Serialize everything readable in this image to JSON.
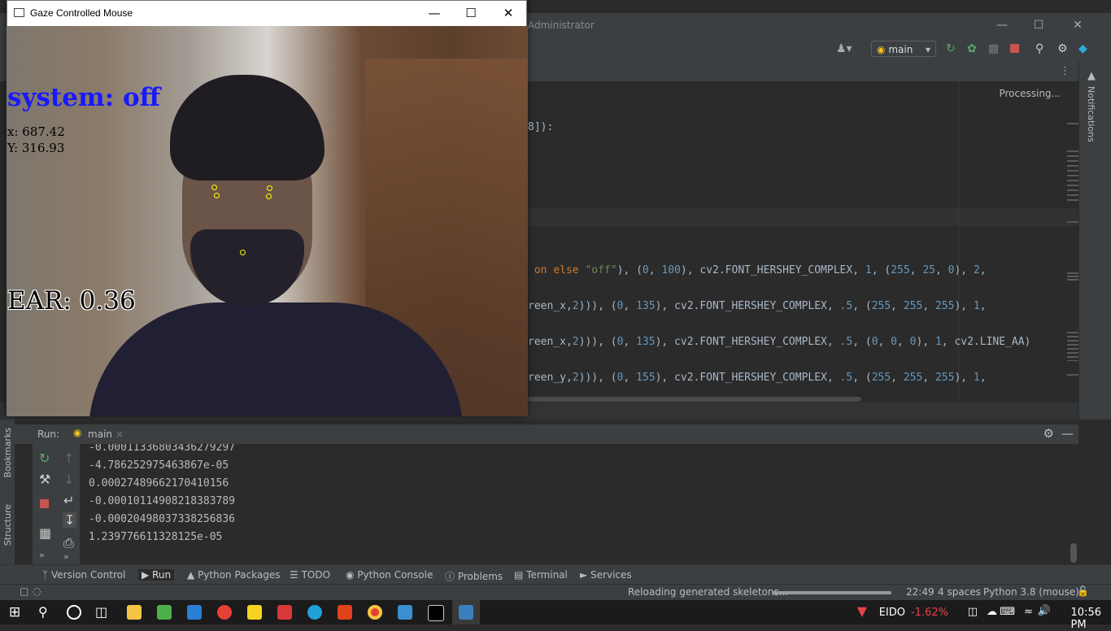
{
  "gaze_window": {
    "title": "Gaze Controlled Mouse",
    "system_status": "system: off",
    "x_readout": "x: 687.42",
    "y_readout": "Y: 316.93",
    "ear_readout": "EAR: 0.36"
  },
  "ide": {
    "title_suffix": "Administrator",
    "run_config": "main",
    "processing": "Processing...",
    "notifications_label": "Notifications",
    "code_lines": [
      {
        "parts": [
          {
            "t": "8]):",
            "c": ""
          }
        ]
      },
      {
        "parts": [
          {
            "t": " on ",
            "c": "kw"
          },
          {
            "t": "else ",
            "c": "kw"
          },
          {
            "t": "\"off\"",
            "c": "str"
          },
          {
            "t": "), (",
            "c": ""
          },
          {
            "t": "0",
            "c": "num"
          },
          {
            "t": ", ",
            "c": ""
          },
          {
            "t": "100",
            "c": "num"
          },
          {
            "t": "), cv2.FONT_HERSHEY_COMPLEX, ",
            "c": ""
          },
          {
            "t": "1",
            "c": "num"
          },
          {
            "t": ", (",
            "c": ""
          },
          {
            "t": "255",
            "c": "num"
          },
          {
            "t": ", ",
            "c": ""
          },
          {
            "t": "25",
            "c": "num"
          },
          {
            "t": ", ",
            "c": ""
          },
          {
            "t": "0",
            "c": "num"
          },
          {
            "t": "), ",
            "c": ""
          },
          {
            "t": "2",
            "c": "num"
          },
          {
            "t": ",",
            "c": ""
          }
        ]
      },
      {
        "parts": [
          {
            "t": "reen_x",
            "c": ""
          },
          {
            "t": ",",
            "c": ""
          },
          {
            "t": "2",
            "c": "num"
          },
          {
            "t": "))), (",
            "c": ""
          },
          {
            "t": "0",
            "c": "num"
          },
          {
            "t": ", ",
            "c": ""
          },
          {
            "t": "135",
            "c": "num"
          },
          {
            "t": "), cv2.FONT_HERSHEY_COMPLEX, ",
            "c": ""
          },
          {
            "t": ".5",
            "c": "num"
          },
          {
            "t": ", (",
            "c": ""
          },
          {
            "t": "255",
            "c": "num"
          },
          {
            "t": ", ",
            "c": ""
          },
          {
            "t": "255",
            "c": "num"
          },
          {
            "t": ", ",
            "c": ""
          },
          {
            "t": "255",
            "c": "num"
          },
          {
            "t": "), ",
            "c": ""
          },
          {
            "t": "1",
            "c": "num"
          },
          {
            "t": ",",
            "c": ""
          }
        ]
      },
      {
        "parts": [
          {
            "t": "reen_x",
            "c": ""
          },
          {
            "t": ",",
            "c": ""
          },
          {
            "t": "2",
            "c": "num"
          },
          {
            "t": "))), (",
            "c": ""
          },
          {
            "t": "0",
            "c": "num"
          },
          {
            "t": ", ",
            "c": ""
          },
          {
            "t": "135",
            "c": "num"
          },
          {
            "t": "), cv2.FONT_HERSHEY_COMPLEX, ",
            "c": ""
          },
          {
            "t": ".5",
            "c": "num"
          },
          {
            "t": ", (",
            "c": ""
          },
          {
            "t": "0",
            "c": "num"
          },
          {
            "t": ", ",
            "c": ""
          },
          {
            "t": "0",
            "c": "num"
          },
          {
            "t": ", ",
            "c": ""
          },
          {
            "t": "0",
            "c": "num"
          },
          {
            "t": "), ",
            "c": ""
          },
          {
            "t": "1",
            "c": "num"
          },
          {
            "t": ", cv2.LINE_AA)",
            "c": ""
          }
        ]
      },
      {
        "parts": [
          {
            "t": "reen_y",
            "c": ""
          },
          {
            "t": ",",
            "c": ""
          },
          {
            "t": "2",
            "c": "num"
          },
          {
            "t": "))), (",
            "c": ""
          },
          {
            "t": "0",
            "c": "num"
          },
          {
            "t": ", ",
            "c": ""
          },
          {
            "t": "155",
            "c": "num"
          },
          {
            "t": "), cv2.FONT_HERSHEY_COMPLEX, ",
            "c": ""
          },
          {
            "t": ".5",
            "c": "num"
          },
          {
            "t": ", (",
            "c": ""
          },
          {
            "t": "255",
            "c": "num"
          },
          {
            "t": ", ",
            "c": ""
          },
          {
            "t": "255",
            "c": "num"
          },
          {
            "t": ", ",
            "c": ""
          },
          {
            "t": "255",
            "c": "num"
          },
          {
            "t": "), ",
            "c": ""
          },
          {
            "t": "1",
            "c": "num"
          },
          {
            "t": ",",
            "c": ""
          }
        ]
      }
    ],
    "run_panel": {
      "label": "Run:",
      "tab": "main",
      "output": [
        "-0.00011336803436279297",
        "-4.786252975463867e-05",
        "0.00027489662170410156",
        "-0.00010114908218383789",
        "-0.00020498037338256836",
        "1.239776611328125e-05"
      ]
    },
    "side_labels": {
      "bookmarks": "Bookmarks",
      "structure": "Structure"
    },
    "bottom_tabs": [
      "Version Control",
      "Run",
      "Python Packages",
      "TODO",
      "Python Console",
      "Problems",
      "Terminal",
      "Services"
    ],
    "status": {
      "message": "Reloading generated skeletons...",
      "position": "22:49",
      "indent": "4 spaces",
      "interpreter": "Python 3.8 (mouse)"
    }
  },
  "taskbar": {
    "ticker": "EIDO",
    "change": "-1.62%",
    "time": "10:56 PM"
  },
  "colors": {
    "accent_blue": "#1919ff",
    "ticker_red": "#e8424b",
    "landmark": "#ffff00"
  }
}
